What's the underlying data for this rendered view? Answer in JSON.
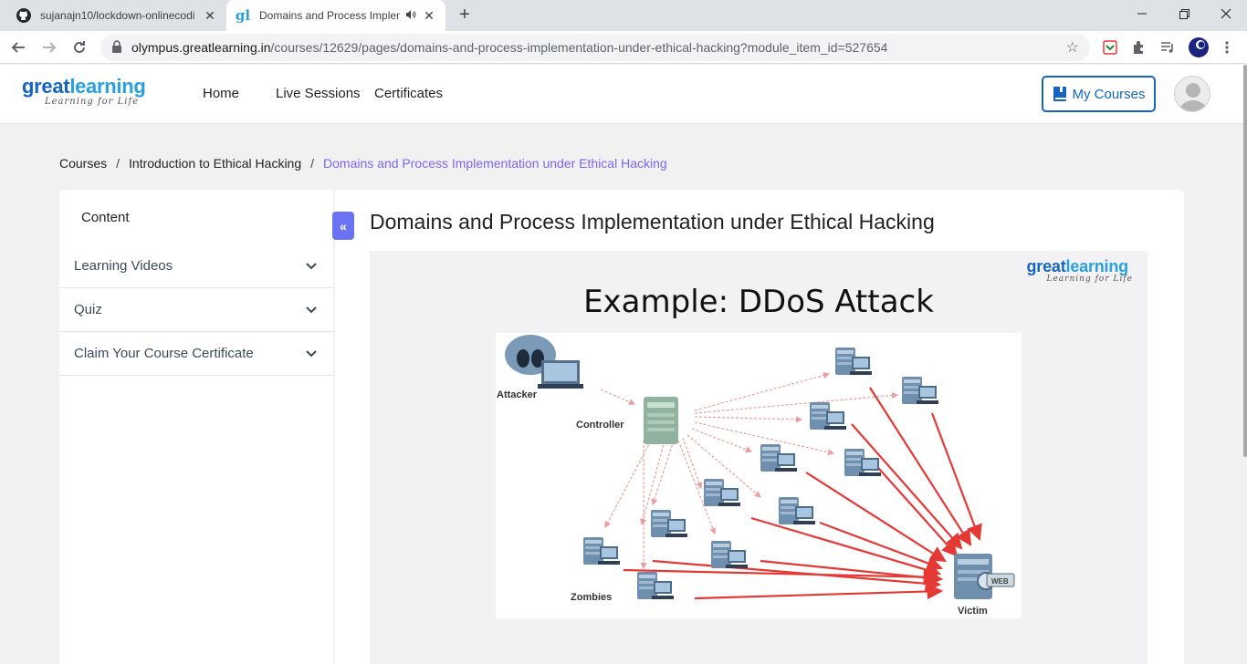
{
  "browser": {
    "tabs": [
      {
        "title": "sujanajn10/lockdown-onlinecodi",
        "icon": "github-icon",
        "active": false
      },
      {
        "title": "Domains and Process Implen",
        "icon": "greatlearning-favicon",
        "active": true
      }
    ],
    "url_host": "olympus.greatlearning.in",
    "url_path": "/courses/12629/pages/domains-and-process-implementation-under-ethical-hacking?module_item_id=527654"
  },
  "header": {
    "logo": {
      "great": "great",
      "learning": "learning",
      "tagline": "Learning for Life"
    },
    "nav": [
      {
        "label": "Home"
      },
      {
        "label": "Live Sessions"
      },
      {
        "label": "Certificates"
      }
    ],
    "my_courses_label": "My Courses"
  },
  "breadcrumb": {
    "items": [
      "Courses",
      "Introduction to Ethical Hacking",
      "Domains and Process Implementation under Ethical Hacking"
    ],
    "separator": "/"
  },
  "sidebar": {
    "heading": "Content",
    "sections": [
      {
        "label": "Learning Videos"
      },
      {
        "label": "Quiz"
      },
      {
        "label": "Claim Your Course Certificate"
      }
    ]
  },
  "main": {
    "title": "Domains and Process Implementation under Ethical Hacking",
    "slide": {
      "title": "Example: DDoS Attack",
      "diagram_labels": {
        "attacker": "Attacker",
        "controller": "Controller",
        "zombies": "Zombies",
        "victim": "Victim",
        "web_badge": "WEB"
      }
    }
  },
  "colors": {
    "brand_blue": "#1565c0",
    "brand_light_blue": "#2a9fe0",
    "breadcrumb_current": "#7b68ee",
    "collapse_button": "#6c73f0",
    "attack_arrow": "#e53935",
    "control_arrow": "#e8a0a0"
  }
}
